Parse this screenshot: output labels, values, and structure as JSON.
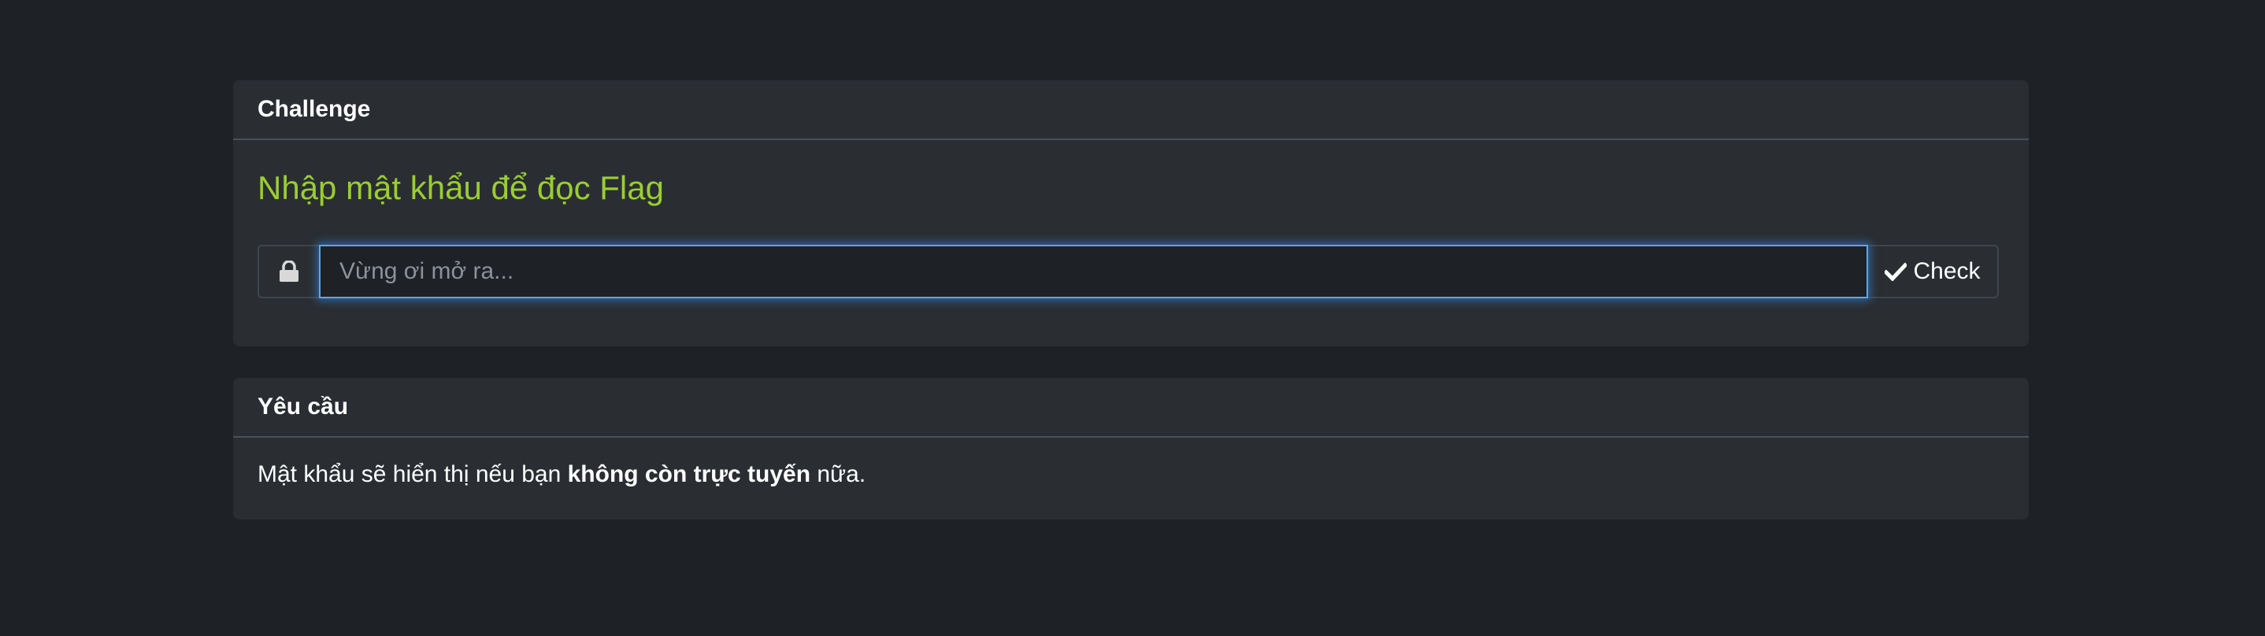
{
  "challenge": {
    "header": "Challenge",
    "title": "Nhập mật khẩu để đọc Flag",
    "lock_icon": "lock-icon",
    "input_value": "",
    "input_placeholder": "Vừng ơi mở ra...",
    "check_icon": "checkmark-icon",
    "check_label": "Check"
  },
  "requirements": {
    "header": "Yêu cầu",
    "text_before": "Mật khẩu sẽ hiển thị nếu bạn ",
    "text_bold": "không còn trực tuyến",
    "text_after": " nữa."
  },
  "colors": {
    "background": "#1e2125",
    "card": "#2a2e33",
    "accent_green": "#9acd32",
    "focus_blue": "#5ca8e8"
  }
}
